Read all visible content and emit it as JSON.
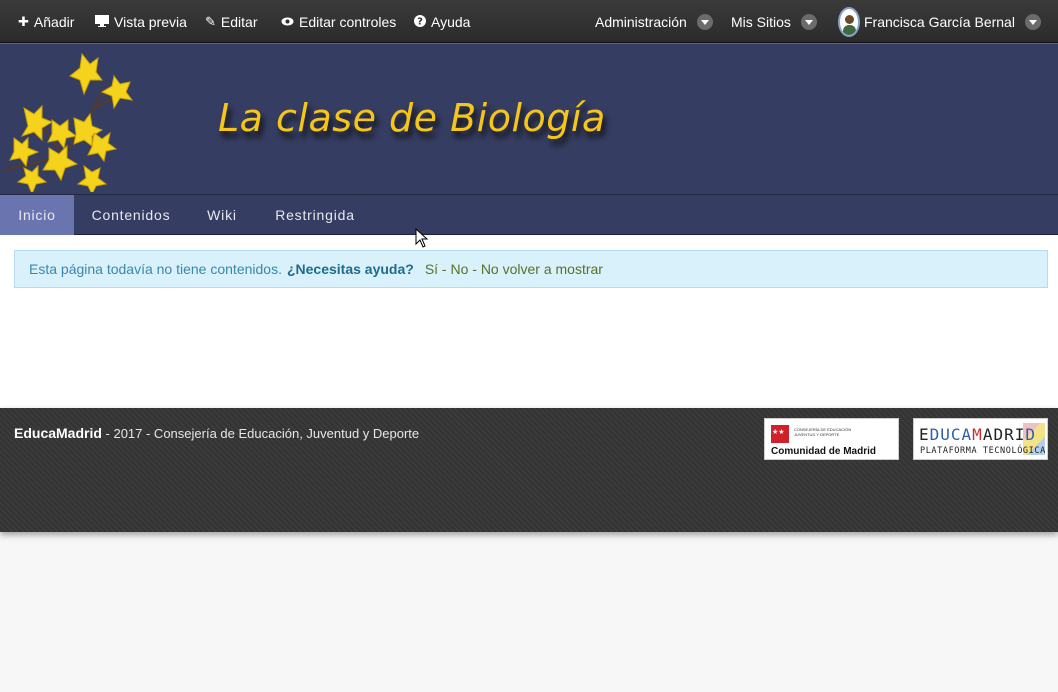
{
  "dockbar": {
    "add": "Añadir",
    "preview": "Vista previa",
    "edit": "Editar",
    "edit_controls": "Editar controles",
    "help": "Ayuda",
    "admin": "Administración",
    "my_sites": "Mis Sitios",
    "user_name": "Francisca García Bernal"
  },
  "site": {
    "title": "La clase de Biología"
  },
  "nav": {
    "items": [
      "Inicio",
      "Contenidos",
      "Wiki",
      "Restringida"
    ],
    "active": "Inicio"
  },
  "alert": {
    "message": "Esta página todavía no tiene contenidos.",
    "help_question": "¿Necesitas ayuda?",
    "options": "Sí - No - No volver a mostrar"
  },
  "footer": {
    "brand": "EducaMadrid",
    "text": " - 2017 - Consejería de Educación, Juventud y Deporte",
    "cam_small_1": "CONSEJERÍA DE EDUCACIÓN",
    "cam_small_2": "JUVENTUD Y DEPORTE",
    "cam_name": "Comunidad de Madrid",
    "edu_logo_text": "EDUCAMADRID",
    "edu_sub": "PLATAFORMA TECNOLÓGICA"
  },
  "colors": {
    "dockbar": "#2f2f2f",
    "banner": "#353d62",
    "nav_active": "#6a75b0",
    "title": "#f6c51a",
    "alert_bg": "#d9f1fa"
  }
}
